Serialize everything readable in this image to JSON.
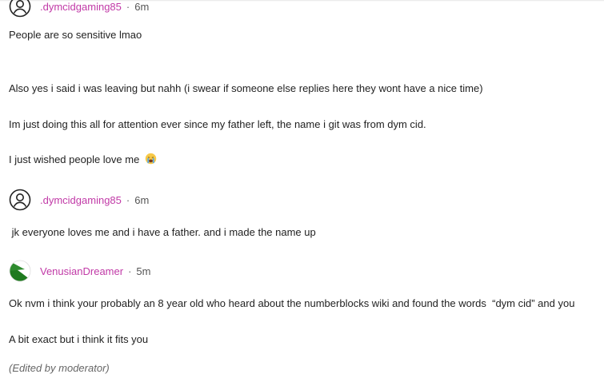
{
  "posts": [
    {
      "username": ".dymcidgaming85",
      "separator": "·",
      "time": "6m",
      "avatar_icon": "user-circle-icon",
      "lines": [
        "People are so sensitive lmao",
        "Also yes i said i was leaving but nahh (i swear if someone else replies here they wont have a nice time)",
        "Im just doing this all for attention ever since my father left, the name i git was from dym cid.",
        "I just wished people love me"
      ],
      "emoji_icon": "crying-face-icon"
    },
    {
      "username": ".dymcidgaming85",
      "separator": "·",
      "time": "6m",
      "avatar_icon": "user-circle-icon",
      "lines": [
        " jk everyone loves me and i have a father. and i made the name up"
      ]
    },
    {
      "username": "VenusianDreamer",
      "separator": "·",
      "time": "5m",
      "avatar_icon": "green-white-circle-avatar",
      "lines": [
        "Ok nvm i think your probably an 8 year old who heard about the numberblocks wiki and found the words  “dym cid” and you",
        "A bit exact but i think it fits you"
      ],
      "edited_note": "(Edited by moderator)"
    }
  ],
  "colors": {
    "username": "#c13aa7",
    "text": "#222222",
    "meta": "#555555"
  }
}
